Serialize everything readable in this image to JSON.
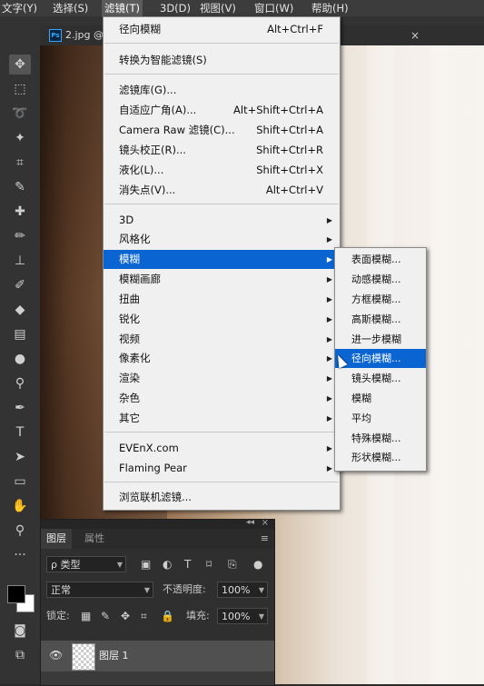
{
  "menubar": {
    "items": [
      {
        "label": "文字(Y)"
      },
      {
        "label": "选择(S)"
      },
      {
        "label": "滤镜(T)"
      },
      {
        "label": "3D(D)"
      },
      {
        "label": "视图(V)"
      },
      {
        "label": "窗口(W)"
      },
      {
        "label": "帮助(H)"
      }
    ]
  },
  "document": {
    "tab_title": "2.jpg @",
    "ps_badge": "Ps",
    "close_glyph": "×"
  },
  "filter_menu": {
    "items": [
      {
        "label": "径向模糊",
        "shortcut": "Alt+Ctrl+F"
      },
      {
        "label": "转换为智能滤镜(S)",
        "shortcut": ""
      },
      {
        "label": "滤镜库(G)...",
        "shortcut": ""
      },
      {
        "label": "自适应广角(A)...",
        "shortcut": "Alt+Shift+Ctrl+A"
      },
      {
        "label": "Camera Raw 滤镜(C)...",
        "shortcut": "Shift+Ctrl+A"
      },
      {
        "label": "镜头校正(R)...",
        "shortcut": "Shift+Ctrl+R"
      },
      {
        "label": "液化(L)...",
        "shortcut": "Shift+Ctrl+X"
      },
      {
        "label": "消失点(V)...",
        "shortcut": "Alt+Ctrl+V"
      },
      {
        "label": "3D",
        "submenu": true
      },
      {
        "label": "风格化",
        "submenu": true
      },
      {
        "label": "模糊",
        "submenu": true,
        "highlighted": true
      },
      {
        "label": "模糊画廊",
        "submenu": true
      },
      {
        "label": "扭曲",
        "submenu": true
      },
      {
        "label": "锐化",
        "submenu": true
      },
      {
        "label": "视频",
        "submenu": true
      },
      {
        "label": "像素化",
        "submenu": true
      },
      {
        "label": "渲染",
        "submenu": true
      },
      {
        "label": "杂色",
        "submenu": true
      },
      {
        "label": "其它",
        "submenu": true
      },
      {
        "label": "EVEnX.com",
        "submenu": true
      },
      {
        "label": "Flaming Pear",
        "submenu": true
      },
      {
        "label": "浏览联机滤镜...",
        "shortcut": ""
      }
    ],
    "arrow_glyph": "▶"
  },
  "blur_submenu": {
    "items": [
      {
        "label": "表面模糊..."
      },
      {
        "label": "动感模糊..."
      },
      {
        "label": "方框模糊..."
      },
      {
        "label": "高斯模糊..."
      },
      {
        "label": "进一步模糊"
      },
      {
        "label": "径向模糊...",
        "highlighted": true
      },
      {
        "label": "镜头模糊..."
      },
      {
        "label": "模糊"
      },
      {
        "label": "平均"
      },
      {
        "label": "特殊模糊..."
      },
      {
        "label": "形状模糊..."
      }
    ]
  },
  "layers_panel": {
    "tab_layers": "图层",
    "tab_properties": "属性",
    "collapse_glyph": "◂◂",
    "close_glyph": "×",
    "menu_glyph": "≡",
    "kind_filter": "ρ 类型",
    "blend_mode": "正常",
    "opacity_label": "不透明度:",
    "opacity_value": "100%",
    "lock_label": "锁定:",
    "fill_label": "填充:",
    "fill_value": "100%",
    "layer_name": "图层 1"
  },
  "colors": {
    "menu_highlight": "#0a64d2",
    "menu_bg": "#f0f0f0",
    "ui_dark": "#333333",
    "foreground_color": "#000000",
    "background_color": "#ffffff"
  },
  "icons": {
    "tools": [
      "move-icon",
      "marquee-icon",
      "lasso-icon",
      "magic-wand-icon",
      "crop-icon",
      "eyedropper-icon",
      "healing-brush-icon",
      "brush-icon",
      "stamp-icon",
      "history-brush-icon",
      "eraser-icon",
      "gradient-icon",
      "blur-tool-icon",
      "dodge-icon",
      "pen-icon",
      "type-icon",
      "path-select-icon",
      "rectangle-icon",
      "hand-icon",
      "zoom-icon",
      "more-tools-icon",
      "quick-mask-icon",
      "screen-mode-icon"
    ]
  }
}
